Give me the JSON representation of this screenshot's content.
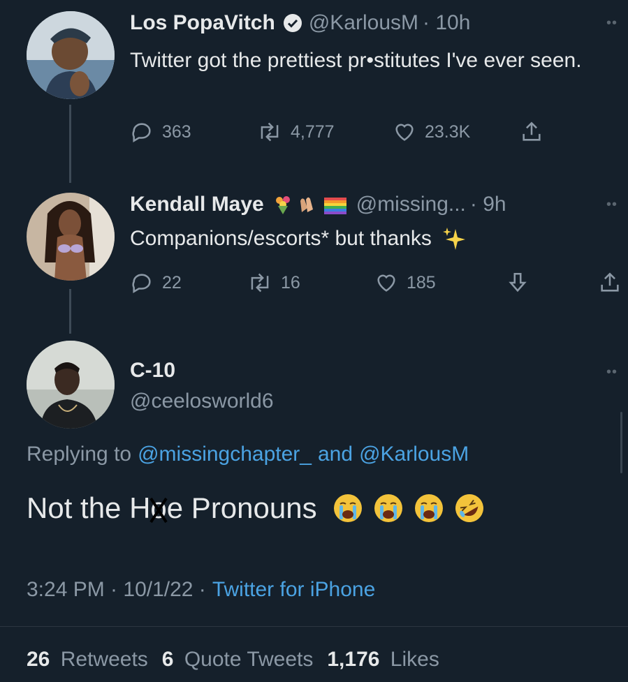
{
  "tweet1": {
    "name": "Los PopaVitch",
    "handle": "@KarlousM",
    "time": "· 10h",
    "text": "Twitter got the prettiest pr•stitutes I've ever seen.",
    "replies": "363",
    "retweets": "4,777",
    "likes": "23.3K"
  },
  "tweet2": {
    "name": "Kendall Maye",
    "handle": "@missing...",
    "time": "· 9h",
    "text": "Companions/escorts* but thanks",
    "replies": "22",
    "retweets": "16",
    "likes": "185"
  },
  "tweet3": {
    "name": "C-10",
    "handle": "@ceelosworld6",
    "replying_prefix": "Replying to",
    "reply_to_1": "@missingchapter_",
    "reply_and": "and",
    "reply_to_2": "@KarlousM",
    "text_before": "Not the H",
    "text_struck": "o",
    "text_after": "e Pronouns",
    "timestamp": "3:24 PM · 10/1/22 ·",
    "source": "Twitter for iPhone",
    "stats": {
      "retweets_count": "26",
      "retweets_label": "Retweets",
      "quotes_count": "6",
      "quotes_label": "Quote Tweets",
      "likes_count": "1,176",
      "likes_label": "Likes"
    }
  },
  "colors": {
    "background": "#15202b",
    "link": "#4ba3e3",
    "muted": "#8b98a5"
  }
}
